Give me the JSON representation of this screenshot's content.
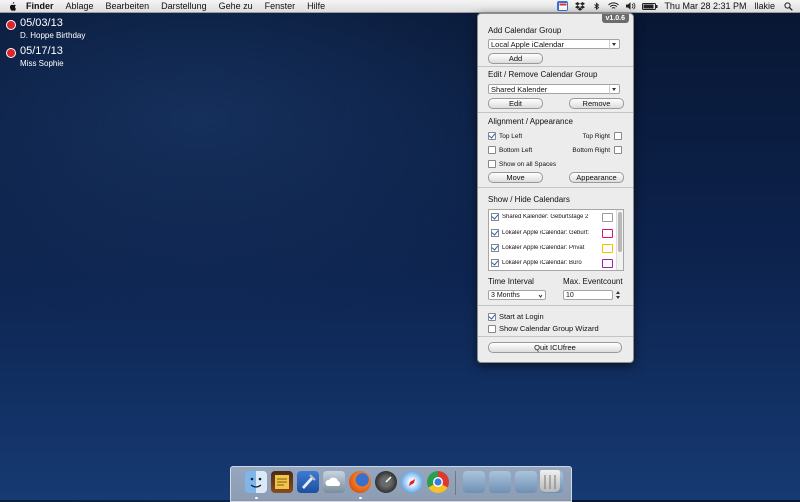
{
  "menubar": {
    "app_name": "Finder",
    "menus": [
      "Ablage",
      "Bearbeiten",
      "Darstellung",
      "Gehe zu",
      "Fenster",
      "Hilfe"
    ],
    "clock": "Thu Mar 28  2:31 PM",
    "user": "llakie",
    "status_icons": [
      "icucal-icon",
      "dropbox-icon",
      "bluetooth-icon",
      "wifi-icon",
      "volume-icon",
      "battery-icon",
      "spotlight-icon"
    ]
  },
  "desktop_events": [
    {
      "date": "05/03/13",
      "title": "D. Hoppe Birthday",
      "color": "#e0232c"
    },
    {
      "date": "05/17/13",
      "title": "Miss Sophie",
      "color": "#e0232c"
    }
  ],
  "panel": {
    "version": "v1.0.6",
    "add_group": {
      "heading": "Add Calendar Group",
      "selected": "Local Apple iCalendar",
      "button": "Add"
    },
    "edit_group": {
      "heading": "Edit / Remove Calendar Group",
      "selected": "Shared Kalender",
      "edit_button": "Edit",
      "remove_button": "Remove"
    },
    "alignment": {
      "heading": "Alignment / Appearance",
      "top_left": {
        "label": "Top Left",
        "checked": true
      },
      "top_right": {
        "label": "Top Right",
        "checked": false
      },
      "bottom_left": {
        "label": "Bottom Left",
        "checked": false
      },
      "bottom_right": {
        "label": "Bottom Right",
        "checked": false
      },
      "show_all_spaces": {
        "label": "Show on all Spaces",
        "checked": false
      },
      "move_button": "Move",
      "appearance_button": "Appearance"
    },
    "calendars": {
      "heading": "Show / Hide Calendars",
      "items": [
        {
          "label": "Shared Kalender: Geburtstage 2",
          "checked": true,
          "color": "#9a9a9a"
        },
        {
          "label": "Lokaler Apple iCalendar: Geburt:",
          "checked": true,
          "color": "#e0117a"
        },
        {
          "label": "Lokaler Apple iCalendar: Privat",
          "checked": true,
          "color": "#f2c200"
        },
        {
          "label": "Lokaler Apple iCalendar: Büro",
          "checked": true,
          "color": "#9b1fb0"
        }
      ]
    },
    "time_interval": {
      "label": "Time Interval",
      "value": "3 Months"
    },
    "max_events": {
      "label": "Max. Eventcount",
      "value": "10"
    },
    "start_at_login": {
      "label": "Start at Login",
      "checked": true
    },
    "show_wizard": {
      "label": "Show Calendar Group  Wizard",
      "checked": false
    },
    "quit_button": "Quit ICUfree"
  },
  "dock": {
    "apps": [
      "finder-icon",
      "notes-app-icon",
      "xcode-icon",
      "cloud-app-icon",
      "firefox-icon",
      "dashboard-icon",
      "safari-icon",
      "chrome-icon"
    ],
    "folders": [
      "applications-folder-icon",
      "documents-folder-icon",
      "downloads-folder-icon",
      "desktop-folder-icon"
    ],
    "trash": "trash-icon"
  }
}
